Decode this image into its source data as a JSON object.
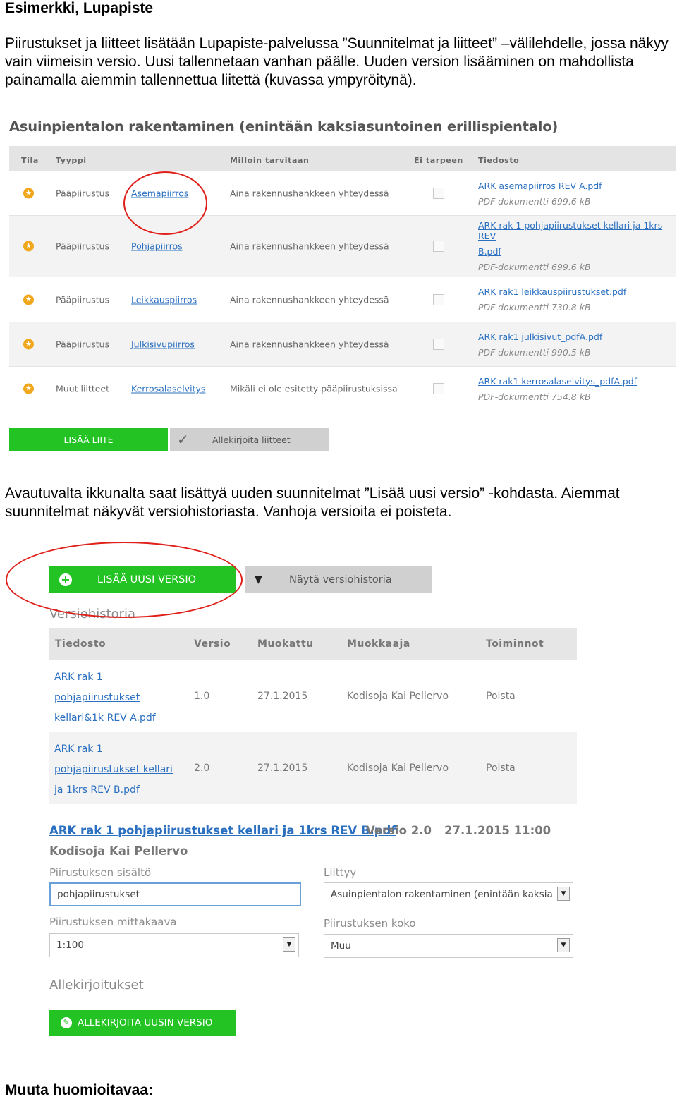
{
  "doc": {
    "heading1": "Esimerkki, Lupapiste",
    "para1": "Piirustukset ja liitteet lisätään Lupapiste-palvelussa ”Suunnitelmat ja liitteet” –välilehdelle, jossa näkyy vain viimeisin versio. Uusi tallennetaan vanhan päälle. Uuden version lisääminen on mahdollista painamalla aiemmin tallennettua liitettä (kuvassa ympyröitynä).",
    "para2": "Avautuvalta ikkunalta saat lisättyä uuden suunnitelmat ”Lisää uusi versio” -kohdasta. Aiemmat suunnitelmat näkyvät versiohistoriasta. Vanhoja versioita ei poisteta.",
    "heading2": "Muuta huomioitavaa:"
  },
  "attachments": {
    "title": "Asuinpientalon rakentaminen (enintään kaksiasuntoinen erillispientalo)",
    "headers": [
      "Tila",
      "Tyyppi",
      "Milloin tarvitaan",
      "Ei tarpeen",
      "Tiedosto"
    ],
    "rows": [
      {
        "type": "Pääpiirustus",
        "name": "Asemapiirros",
        "when": "Aina rakennushankkeen yhteydessä",
        "file": "ARK asemapiirros REV A.pdf",
        "file2": "",
        "meta": "PDF-dokumentti 699.6 kB"
      },
      {
        "type": "Pääpiirustus",
        "name": "Pohjapiirros",
        "when": "Aina rakennushankkeen yhteydessä",
        "file": "ARK rak 1 pohjapiirustukset kellari ja 1krs REV",
        "file2": "B.pdf",
        "meta": "PDF-dokumentti 699.6 kB"
      },
      {
        "type": "Pääpiirustus",
        "name": "Leikkauspiirros",
        "when": "Aina rakennushankkeen yhteydessä",
        "file": "ARK rak1 leikkauspiirustukset.pdf",
        "file2": "",
        "meta": "PDF-dokumentti 730.8 kB"
      },
      {
        "type": "Pääpiirustus",
        "name": "Julkisivupiirros",
        "when": "Aina rakennushankkeen yhteydessä",
        "file": "ARK rak1 julkisivut_pdfA.pdf",
        "file2": "",
        "meta": "PDF-dokumentti 990.5 kB"
      },
      {
        "type": "Muut liitteet",
        "name": "Kerrosalaselvitys",
        "when": "Mikäli ei ole esitetty pääpiirustuksissa",
        "file": "ARK rak1 kerrosalaselvitys_pdfA.pdf",
        "file2": "",
        "meta": "PDF-dokumentti 754.8 kB"
      }
    ],
    "add_button": "LISÄÄ LIITE",
    "sign_button": "Allekirjoita liitteet"
  },
  "version": {
    "add_version_button": "LISÄÄ UUSI VERSIO",
    "show_history_button": "Näytä versiohistoria",
    "history_title": "Versiohistoria",
    "headers": [
      "Tiedosto",
      "Versio",
      "Muokattu",
      "Muokkaaja",
      "Toiminnot"
    ],
    "rows": [
      {
        "file_lines": [
          "ARK rak 1",
          "pohjapiirustukset",
          "kellari&1k REV A.pdf"
        ],
        "version": "1.0",
        "modified": "27.1.2015",
        "editor": "Kodisoja Kai Pellervo",
        "action": "Poista"
      },
      {
        "file_lines": [
          "ARK rak 1",
          "pohjapiirustukset kellari",
          "ja 1krs REV B.pdf"
        ],
        "version": "2.0",
        "modified": "27.1.2015",
        "editor": "Kodisoja Kai Pellervo",
        "action": "Poista"
      }
    ],
    "current_file": "ARK rak 1 pohjapiirustukset kellari ja 1krs REV B.pdf",
    "current_version": "Versio 2.0",
    "current_timestamp": "27.1.2015 11:00",
    "current_editor": "Kodisoja Kai Pellervo",
    "content_label": "Piirustuksen sisältö",
    "content_value": "pohjapiirustukset",
    "relates_label": "Liittyy",
    "relates_value": "Asuinpientalon rakentaminen (enintään kaksia",
    "scale_label": "Piirustuksen mittakaava",
    "scale_value": "1:100",
    "size_label": "Piirustuksen koko",
    "size_value": "Muu",
    "signatures_label": "Allekirjoitukset",
    "sign_version_button": "ALLEKIRJOITA UUSIN VERSIO"
  },
  "colors": {
    "green": "#22c322",
    "link": "#2a6fc0",
    "star": "#f0a71c",
    "circle": "#e0201a"
  }
}
